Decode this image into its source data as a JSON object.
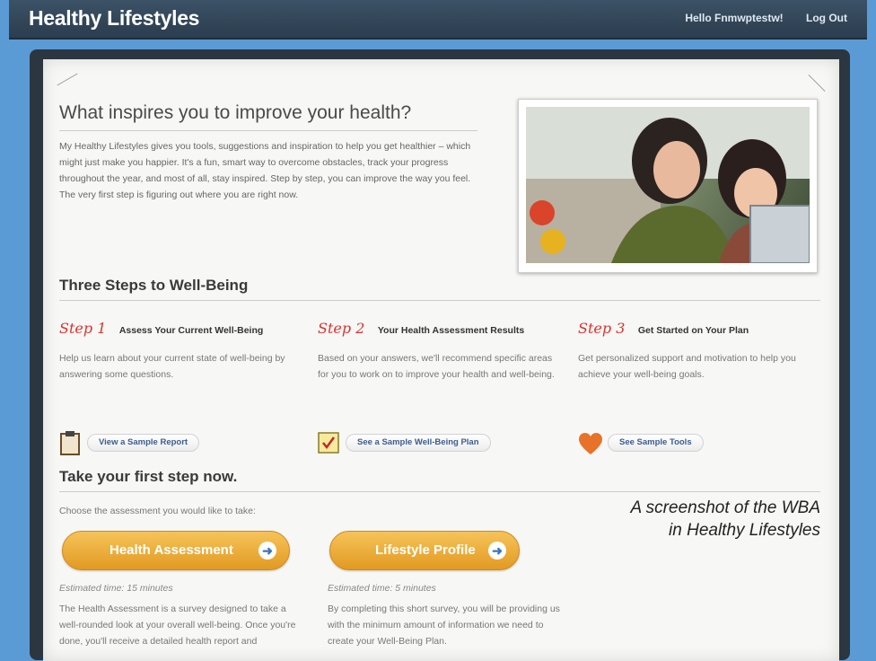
{
  "header": {
    "brand": "Healthy Lifestyles",
    "greeting": "Hello Fnmwptestw!",
    "logout": "Log Out"
  },
  "intro": {
    "title": "What inspires you to improve your health?",
    "body": "My Healthy Lifestyles gives you tools, suggestions and inspiration to help you get healthier – which might just make you happier. It's a fun, smart way to overcome obstacles, track your progress throughout the year, and most of all, stay inspired. Step by step, you can improve the way you feel. The very first step is figuring out where you are right now."
  },
  "steps": {
    "heading": "Three Steps to Well-Being",
    "items": [
      {
        "num": "Step 1",
        "title": "Assess Your Current Well-Being",
        "desc": "Help us learn about your current state of well-being by answering some questions.",
        "action": "View a Sample Report",
        "icon": "clipboard-icon"
      },
      {
        "num": "Step 2",
        "title": "Your Health Assessment Results",
        "desc": "Based on your answers, we'll recommend specific areas for you to work on to improve your health and well-being.",
        "action": "See a Sample Well-Being Plan",
        "icon": "checkbox-icon"
      },
      {
        "num": "Step 3",
        "title": "Get Started on Your Plan",
        "desc": "Get personalized support and motivation to help you achieve your well-being goals.",
        "action": "See Sample Tools",
        "icon": "heart-icon"
      }
    ]
  },
  "first_step": {
    "heading": "Take your first step now.",
    "choose": "Choose the assessment you would like to take:",
    "assessments": [
      {
        "label": "Health Assessment",
        "time": "Estimated time: 15 minutes",
        "desc": "The Health Assessment is a survey designed to take a well-rounded look at your overall well-being. Once you're done, you'll receive a detailed health report and"
      },
      {
        "label": "Lifestyle Profile",
        "time": "Estimated time: 5 minutes",
        "desc": "By completing this short survey, you will be providing us with the minimum amount of information we need to create your Well-Being Plan."
      }
    ]
  },
  "caption": {
    "line1": "A screenshot of the WBA",
    "line2": "in Healthy Lifestyles"
  },
  "colors": {
    "accent_orange": "#e8a22c",
    "step_red": "#d8332e",
    "link_blue": "#3b5c8f",
    "header_bg": "#34495c"
  }
}
